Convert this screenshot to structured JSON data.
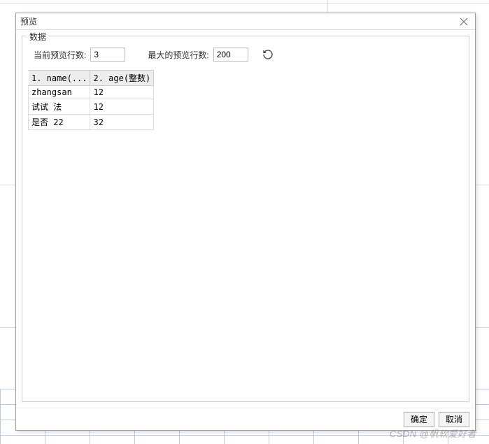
{
  "dialog": {
    "title": "预览",
    "fieldset_legend": "数据",
    "current_rows_label": "当前预览行数:",
    "current_rows_value": "3",
    "max_rows_label": "最大的预览行数:",
    "max_rows_value": "200",
    "columns": [
      "1. name(...",
      "2. age(整数)"
    ],
    "rows": [
      {
        "name": "zhangsan",
        "age": "12"
      },
      {
        "name": "试试 法",
        "age": "12"
      },
      {
        "name": "是否 22",
        "age": "32"
      }
    ],
    "ok_label": "确定",
    "cancel_label": "取消"
  },
  "watermark": "CSDN @帆软爱好者"
}
